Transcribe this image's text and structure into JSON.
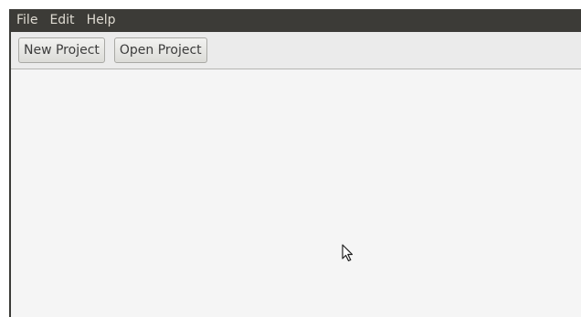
{
  "menubar": {
    "items": [
      {
        "label": "File"
      },
      {
        "label": "Edit"
      },
      {
        "label": "Help"
      }
    ]
  },
  "toolbar": {
    "new_project_label": "New Project",
    "open_project_label": "Open Project"
  },
  "colors": {
    "menubar_bg": "#3c3b37",
    "menubar_text": "#dfdbd2",
    "toolbar_bg": "#ebebeb",
    "content_bg": "#f5f5f5"
  },
  "icons": {
    "cursor": "mouse-pointer-icon"
  }
}
